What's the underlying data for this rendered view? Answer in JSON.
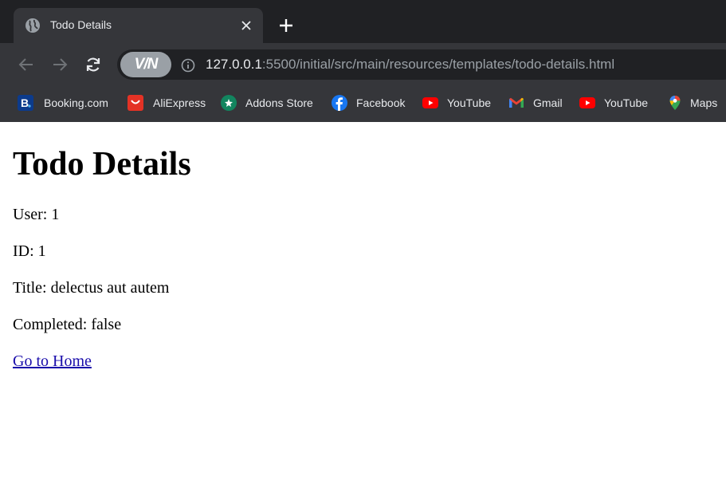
{
  "browser": {
    "tab": {
      "title": "Todo Details",
      "favicon": "globe-icon"
    },
    "new_tab_icon": "plus-icon",
    "address_bar": {
      "extension_label": "V/N",
      "url_host": "127.0.0.1",
      "url_rest": ":5500/initial/src/main/resources/templates/todo-details.html"
    },
    "bookmarks": [
      {
        "label": "Booking.com",
        "icon": "booking-icon"
      },
      {
        "label": "AliExpress",
        "icon": "aliexpress-icon"
      },
      {
        "label": "Addons Store",
        "icon": "addons-store-icon"
      },
      {
        "label": "Facebook",
        "icon": "facebook-icon"
      },
      {
        "label": "YouTube",
        "icon": "youtube-icon"
      },
      {
        "label": "Gmail",
        "icon": "gmail-icon"
      },
      {
        "label": "YouTube",
        "icon": "youtube-icon"
      },
      {
        "label": "Maps",
        "icon": "maps-icon"
      }
    ]
  },
  "page": {
    "title": "Todo Details",
    "fields": {
      "user": "User: 1",
      "id": "ID: 1",
      "title": "Title: delectus aut autem",
      "completed": "Completed: false"
    },
    "home_link": "Go to Home"
  },
  "colors": {
    "chrome_dark": "#202124",
    "chrome_toolbar": "#35363a",
    "link": "#1a0dab"
  }
}
